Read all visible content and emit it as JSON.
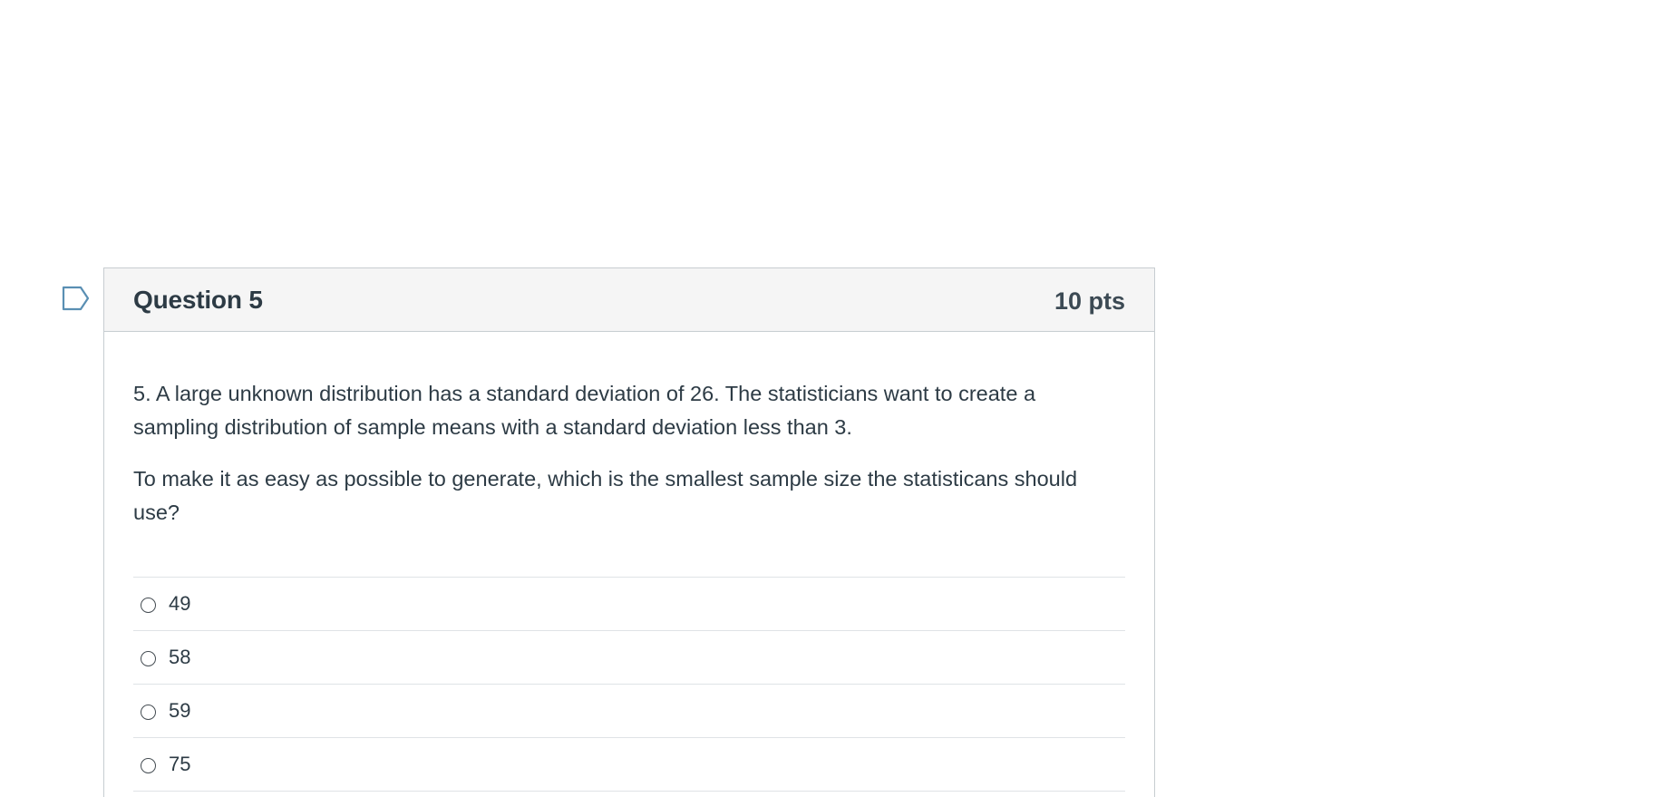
{
  "question": {
    "title": "Question 5",
    "points": "10 pts",
    "paragraphs": [
      "5. A large unknown distribution has a standard deviation of 26. The statisticians want to create a sampling distribution of sample means with a standard deviation less than 3.",
      "To make it as easy as possible to generate, which is the smallest sample size the statisticans should use?"
    ],
    "answers": [
      {
        "label": "49",
        "selected": false
      },
      {
        "label": "58",
        "selected": false
      },
      {
        "label": "59",
        "selected": false
      },
      {
        "label": "75",
        "selected": false
      }
    ]
  },
  "icons": {
    "flag": "flag-question-icon",
    "radio": "radio-unselected-icon"
  },
  "colors": {
    "header_background": "#f5f5f5",
    "border": "#c7cdd1",
    "text": "#2d3b45",
    "flag_outline": "#5a8fb3"
  }
}
